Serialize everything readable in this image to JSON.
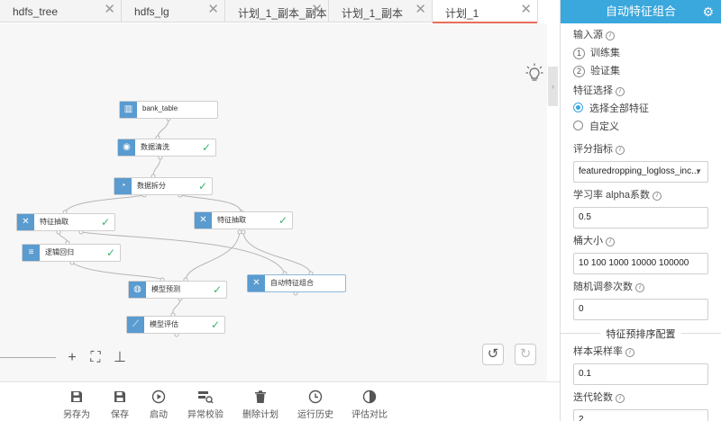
{
  "tabs": [
    {
      "label": "hdfs_tree",
      "active": false
    },
    {
      "label": "hdfs_lg",
      "active": false
    },
    {
      "label": "计划_1_副本_副本",
      "active": false
    },
    {
      "label": "计划_1_副本",
      "active": false
    },
    {
      "label": "计划_1",
      "active": true
    }
  ],
  "tab_close_glyph": "✕",
  "canvas": {
    "nodes": [
      {
        "label": "bank_table",
        "icon": "table-icon",
        "status": "none"
      },
      {
        "label": "数据清洗",
        "icon": "clean-icon",
        "status": "success"
      },
      {
        "label": "数据拆分",
        "icon": "split-icon",
        "status": "success"
      },
      {
        "label": "特征抽取",
        "icon": "feature-icon",
        "status": "success"
      },
      {
        "label": "特征抽取",
        "icon": "feature-icon",
        "status": "success"
      },
      {
        "label": "逻辑回归",
        "icon": "regression-icon",
        "status": "success"
      },
      {
        "label": "模型预测",
        "icon": "predict-icon",
        "status": "success"
      },
      {
        "label": "自动特征组合",
        "icon": "feature-icon",
        "status": "selected"
      },
      {
        "label": "模型评估",
        "icon": "evaluate-icon",
        "status": "success"
      }
    ],
    "status_glyph": "✓"
  },
  "toolbar": {
    "buttons": [
      {
        "label": "另存为",
        "icon": "save-as-icon"
      },
      {
        "label": "保存",
        "icon": "save-icon"
      },
      {
        "label": "启动",
        "icon": "play-icon"
      },
      {
        "label": "异常校验",
        "icon": "check-icon"
      },
      {
        "label": "删除计划",
        "icon": "trash-icon"
      },
      {
        "label": "运行历史",
        "icon": "clock-icon"
      },
      {
        "label": "评估对比",
        "icon": "compare-icon"
      }
    ]
  },
  "panel": {
    "title": "自动特征组合",
    "input_source_label": "输入源",
    "inputs": [
      {
        "num": "1",
        "label": "训练集"
      },
      {
        "num": "2",
        "label": "验证集"
      }
    ],
    "feature_select_label": "特征选择",
    "feature_options": [
      {
        "label": "选择全部特征",
        "selected": true
      },
      {
        "label": "自定义",
        "selected": false
      }
    ],
    "metric_label": "评分指标",
    "metric_value": "featuredropping_logloss_inc...",
    "alpha_label": "学习率 alpha系数",
    "alpha_value": "0.5",
    "bucket_label": "桶大小",
    "bucket_value": "10 100 1000 10000 100000",
    "tune_label": "随机调参次数",
    "tune_value": "0",
    "section_title": "特征预排序配置",
    "sample_label": "样本采样率",
    "sample_value": "0.1",
    "iter_label": "迭代轮数",
    "iter_value": "2"
  },
  "colors": {
    "accent": "#3aa7dd",
    "node_icon": "#5a9bd0",
    "success": "#3cb371",
    "active_tab_underline": "#e86e5b"
  }
}
